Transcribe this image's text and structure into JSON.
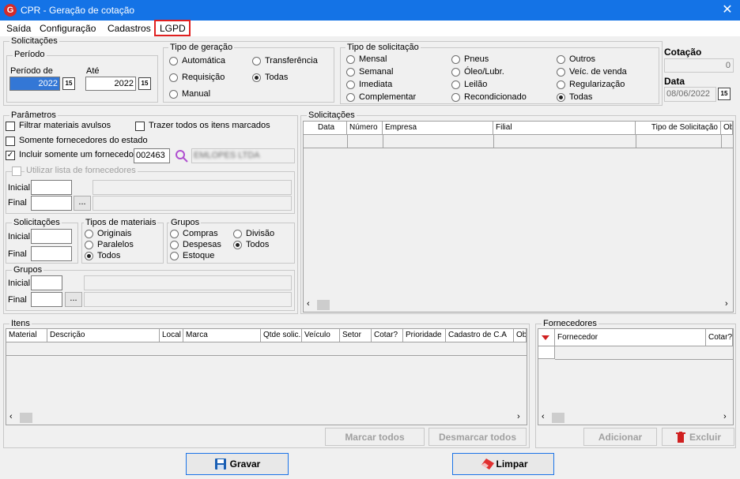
{
  "window": {
    "title": "CPR - Geração de cotação",
    "close_glyph": "✕",
    "icon_glyph": "G"
  },
  "menu": {
    "items": [
      "Saída",
      "Configuração",
      "Cadastros",
      "LGPD"
    ]
  },
  "solicitacoes_group": {
    "title": "Solicitações"
  },
  "periodo": {
    "title": "Período",
    "from_label": "Período de",
    "to_label": "Até",
    "from_value": "2022",
    "to_value": "2022",
    "cal_glyph": "15"
  },
  "tipo_geracao": {
    "title": "Tipo de geração",
    "options": [
      "Automática",
      "Transferência",
      "Requisição",
      "Todas",
      "Manual"
    ],
    "selected": "Todas"
  },
  "tipo_solicitacao": {
    "title": "Tipo de solicitação",
    "options": [
      "Mensal",
      "Pneus",
      "Outros",
      "Semanal",
      "Óleo/Lubr.",
      "Veíc. de venda",
      "Imediata",
      "Leilão",
      "Regularização",
      "Complementar",
      "Recondicionado",
      "Todas"
    ],
    "selected": "Todas"
  },
  "cotacao": {
    "label": "Cotação",
    "value": "0"
  },
  "data": {
    "label": "Data",
    "value": "08/06/2022",
    "cal_glyph": "15"
  },
  "parametros": {
    "title": "Parâmetros",
    "filtrar_avulsos": "Filtrar materiais avulsos",
    "trazer_marcados": "Trazer todos os itens marcados",
    "somente_estado": "Somente fornecedores do estado",
    "incluir_fornecedor": "Incluir somente um fornecedor",
    "fornecedor_code": "002463",
    "fornecedor_name": "EMLOPES LTDA",
    "check_glyph": "✓",
    "utilizar_lista": "Utilizar lista de fornecedores",
    "inicial": "Inicial",
    "final": "Final",
    "ellipsis": "..."
  },
  "solicitacoes_sub": {
    "title": "Solicitações",
    "inicial": "Inicial",
    "final": "Final"
  },
  "tipos_materiais": {
    "title": "Tipos de materiais",
    "options": [
      "Originais",
      "Paralelos",
      "Todos"
    ],
    "selected": "Todos"
  },
  "grupos_radio": {
    "title": "Grupos",
    "options": [
      "Compras",
      "Divisão",
      "Despesas",
      "Todos",
      "Estoque"
    ],
    "selected": "Todos"
  },
  "grupos": {
    "title": "Grupos",
    "inicial": "Inicial",
    "final": "Final",
    "ellipsis": "..."
  },
  "solicitacoes_grid": {
    "title": "Solicitações",
    "columns": [
      "Data",
      "Número",
      "Empresa",
      "Filial",
      "Tipo de Solicitação",
      "Ob"
    ]
  },
  "itens_grid": {
    "title": "Itens",
    "columns": [
      "Material",
      "Descrição",
      "Local",
      "Marca",
      "Qtde solic.",
      "Veículo",
      "Setor",
      "Cotar?",
      "Prioridade",
      "Cadastro de C.A",
      "Ob"
    ]
  },
  "itens_buttons": {
    "marcar": "Marcar todos",
    "desmarcar": "Desmarcar todos"
  },
  "fornecedores_grid": {
    "title": "Fornecedores",
    "columns": [
      "Fornecedor",
      "Cotar?"
    ]
  },
  "fornecedores_buttons": {
    "adicionar": "Adicionar",
    "excluir": "Excluir"
  },
  "footer": {
    "gravar": "Gravar",
    "limpar": "Limpar"
  },
  "scroll": {
    "left": "‹",
    "right": "›"
  },
  "colors": {
    "titlebar": "#1473e6",
    "highlight": "#e02020",
    "selection": "#3377d6",
    "search_icon": "#b050d0",
    "trash_icon": "#d02020"
  }
}
